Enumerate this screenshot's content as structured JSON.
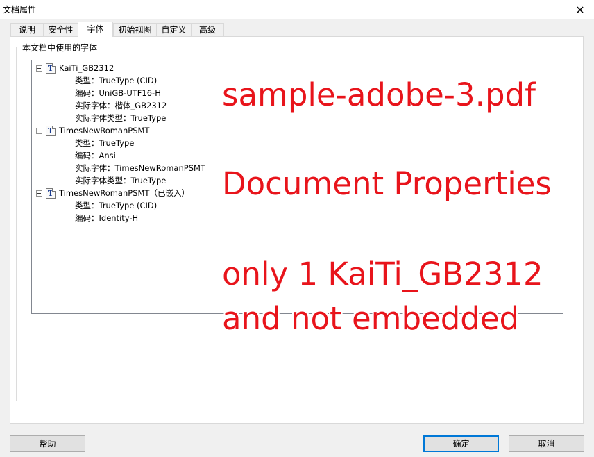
{
  "window": {
    "title": "文档属性",
    "close_glyph": "✕"
  },
  "tabs": [
    {
      "label": "说明"
    },
    {
      "label": "安全性"
    },
    {
      "label": "字体",
      "active": true
    },
    {
      "label": "初始视图"
    },
    {
      "label": "自定义"
    },
    {
      "label": "高级"
    }
  ],
  "group": {
    "legend": "本文档中使用的字体"
  },
  "fonts": [
    {
      "name": "KaiTi_GB2312",
      "icon": "truetype-font-icon",
      "props": [
        "类型：TrueType (CID)",
        "编码：UniGB-UTF16-H",
        "实际字体：楷体_GB2312",
        "实际字体类型：TrueType"
      ]
    },
    {
      "name": "TimesNewRomanPSMT",
      "icon": "truetype-font-icon",
      "props": [
        "类型：TrueType",
        "编码：Ansi",
        "实际字体：TimesNewRomanPSMT",
        "实际字体类型：TrueType"
      ]
    },
    {
      "name": "TimesNewRomanPSMT（已嵌入）",
      "icon": "truetype-font-icon",
      "props": [
        "类型：TrueType (CID)",
        "编码：Identity-H"
      ]
    }
  ],
  "annotation": {
    "line1": "sample-adobe-3.pdf",
    "line2": "Document Properties",
    "line3": "only 1 KaiTi_GB2312",
    "line4": "and not embedded",
    "color": "#e8141b"
  },
  "buttons": {
    "help": "帮助",
    "ok": "确定",
    "cancel": "取消"
  }
}
